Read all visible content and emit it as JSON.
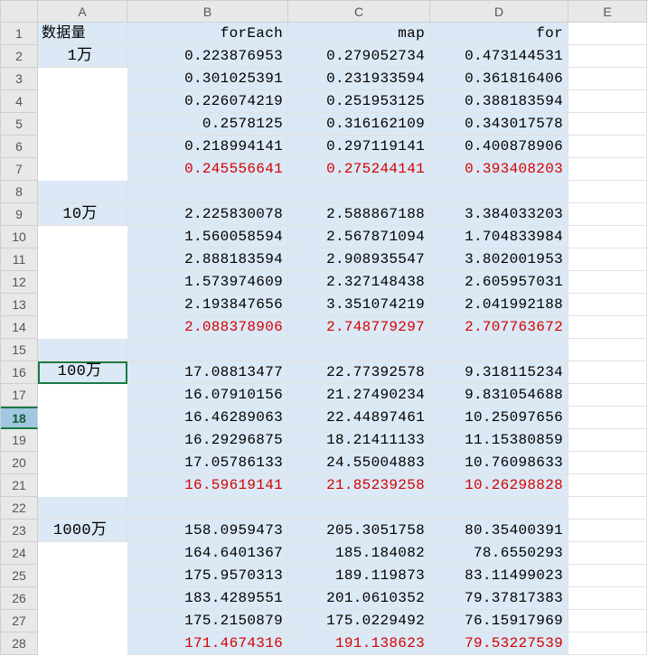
{
  "columns": [
    "A",
    "B",
    "C",
    "D",
    "E"
  ],
  "row_numbers": [
    1,
    2,
    3,
    4,
    5,
    6,
    7,
    8,
    9,
    10,
    11,
    12,
    13,
    14,
    15,
    16,
    17,
    18,
    19,
    20,
    21,
    22,
    23,
    24,
    25,
    26,
    27,
    28
  ],
  "selected_row": 18,
  "header": {
    "A": "数据量",
    "B": "forEach",
    "C": "map",
    "D": "for"
  },
  "groups": [
    {
      "label": "1万",
      "data": [
        [
          "0.223876953",
          "0.279052734",
          "0.473144531"
        ],
        [
          "0.301025391",
          "0.231933594",
          "0.361816406"
        ],
        [
          "0.226074219",
          "0.251953125",
          "0.388183594"
        ],
        [
          "0.2578125",
          "0.316162109",
          "0.343017578"
        ],
        [
          "0.218994141",
          "0.297119141",
          "0.400878906"
        ]
      ],
      "avg": [
        "0.245556641",
        "0.275244141",
        "0.393408203"
      ]
    },
    {
      "label": "10万",
      "data": [
        [
          "2.225830078",
          "2.588867188",
          "3.384033203"
        ],
        [
          "1.560058594",
          "2.567871094",
          "1.704833984"
        ],
        [
          "2.888183594",
          "2.908935547",
          "3.802001953"
        ],
        [
          "1.573974609",
          "2.327148438",
          "2.605957031"
        ],
        [
          "2.193847656",
          "3.351074219",
          "2.041992188"
        ]
      ],
      "avg": [
        "2.088378906",
        "2.748779297",
        "2.707763672"
      ]
    },
    {
      "label": "100万",
      "data": [
        [
          "17.08813477",
          "22.77392578",
          "9.318115234"
        ],
        [
          "16.07910156",
          "21.27490234",
          "9.831054688"
        ],
        [
          "16.46289063",
          "22.44897461",
          "10.25097656"
        ],
        [
          "16.29296875",
          "18.21411133",
          "11.15380859"
        ],
        [
          "17.05786133",
          "24.55004883",
          "10.76098633"
        ]
      ],
      "avg": [
        "16.59619141",
        "21.85239258",
        "10.26298828"
      ]
    },
    {
      "label": "1000万",
      "data": [
        [
          "158.0959473",
          "205.3051758",
          "80.35400391"
        ],
        [
          "164.6401367",
          "185.184082",
          "78.6550293"
        ],
        [
          "175.9570313",
          "189.119873",
          "83.11499023"
        ],
        [
          "183.4289551",
          "201.0610352",
          "79.37817383"
        ],
        [
          "175.2150879",
          "175.0229492",
          "76.15917969"
        ]
      ],
      "avg": [
        "171.4674316",
        "191.138623",
        "79.53227539"
      ]
    }
  ]
}
